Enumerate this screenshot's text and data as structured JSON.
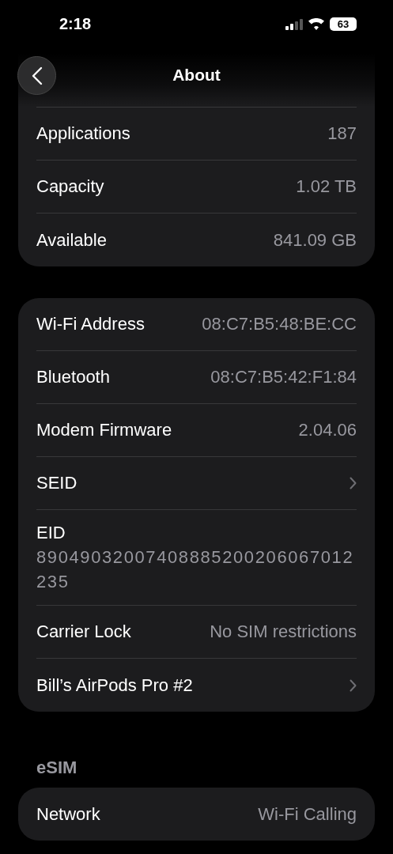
{
  "status_bar": {
    "time": "2:18",
    "battery": "63"
  },
  "nav": {
    "title": "About"
  },
  "sections": [
    {
      "rows": [
        {
          "kind": "value",
          "label": "Applications",
          "value": "187"
        },
        {
          "kind": "value",
          "label": "Capacity",
          "value": "1.02 TB"
        },
        {
          "kind": "value",
          "label": "Available",
          "value": "841.09 GB"
        }
      ]
    },
    {
      "rows": [
        {
          "kind": "value",
          "label": "Wi-Fi Address",
          "value": "08:C7:B5:48:BE:CC"
        },
        {
          "kind": "value",
          "label": "Bluetooth",
          "value": "08:C7:B5:42:F1:84"
        },
        {
          "kind": "value",
          "label": "Modem Firmware",
          "value": "2.04.06"
        },
        {
          "kind": "chevron",
          "label": "SEID"
        },
        {
          "kind": "stacked",
          "label": "EID",
          "value": "89049032007408885200206067012235"
        },
        {
          "kind": "value",
          "label": "Carrier Lock",
          "value": "No SIM restrictions"
        },
        {
          "kind": "chevron",
          "label": "Bill’s AirPods Pro #2"
        }
      ]
    },
    {
      "header": "eSIM",
      "rows": [
        {
          "kind": "value",
          "label": "Network",
          "value": "Wi-Fi Calling"
        }
      ]
    }
  ]
}
